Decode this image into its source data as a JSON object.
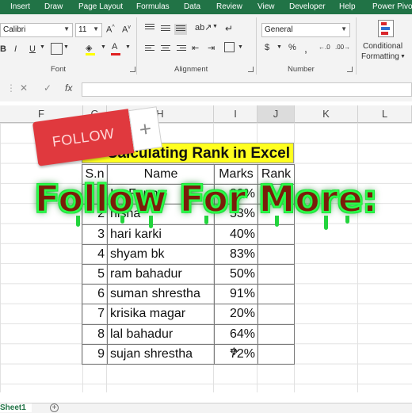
{
  "ribbon_tabs": [
    "Insert",
    "Draw",
    "Page Layout",
    "Formulas",
    "Data",
    "Review",
    "View",
    "Developer",
    "Help",
    "Power Pivot"
  ],
  "font": {
    "name": "Calibri",
    "size": "11"
  },
  "number_format": "General",
  "group_labels": {
    "font": "Font",
    "alignment": "Alignment",
    "number": "Number"
  },
  "conditional_formatting": {
    "line1": "Conditional",
    "line2": "Formatting"
  },
  "formula_bar": {
    "cancel": "✕",
    "enter": "✓",
    "fx": "fx",
    "value": ""
  },
  "columns": [
    "F",
    "G",
    "H",
    "I",
    "J",
    "K",
    "L"
  ],
  "selected_column": "J",
  "sheet": {
    "title": "Calculating Rank in Excel",
    "headers": [
      "S.n",
      "Name",
      "Marks",
      "Rank"
    ],
    "rows": [
      {
        "sn": "1",
        "name": "Ira Farma",
        "marks": "80%",
        "rank": ""
      },
      {
        "sn": "2",
        "name": "nisha",
        "marks": "53%",
        "rank": ""
      },
      {
        "sn": "3",
        "name": "hari karki",
        "marks": "40%",
        "rank": ""
      },
      {
        "sn": "4",
        "name": "shyam bk",
        "marks": "83%",
        "rank": ""
      },
      {
        "sn": "5",
        "name": "ram bahadur",
        "marks": "50%",
        "rank": ""
      },
      {
        "sn": "6",
        "name": "suman shrestha",
        "marks": "91%",
        "rank": ""
      },
      {
        "sn": "7",
        "name": "krisika magar",
        "marks": "20%",
        "rank": ""
      },
      {
        "sn": "8",
        "name": "lal bahadur",
        "marks": "64%",
        "rank": ""
      },
      {
        "sn": "9",
        "name": "sujan shrestha",
        "marks": "72%",
        "rank": ""
      }
    ]
  },
  "overlay": {
    "follow_button": "FOLLOW",
    "follow_plus": "+",
    "banner": "Follow For More:"
  },
  "sheet_tab": "Sheet1",
  "add_sheet": "+",
  "colors": {
    "excel_green": "#217346",
    "title_fill": "#ffff1f",
    "follow_red": "#e0393e",
    "banner_glow": "#2bff4a"
  }
}
